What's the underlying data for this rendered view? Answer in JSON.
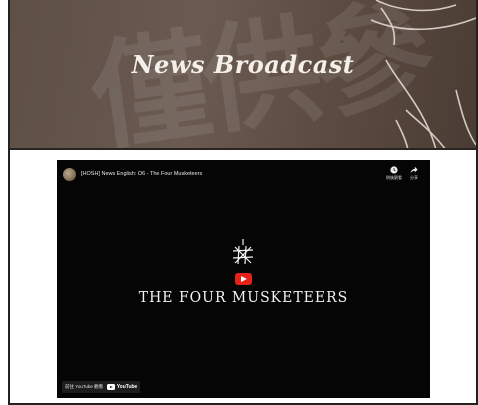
{
  "banner": {
    "title": "News Broadcast",
    "watermark": "僅供參"
  },
  "video": {
    "title": "[HOSH] News English: O6 - The Four Musketeers",
    "actions": [
      {
        "icon": "clock-icon",
        "label": "稍後觀看"
      },
      {
        "icon": "share-icon",
        "label": "分享"
      }
    ],
    "main_title": "THE FOUR MUSKETEERS",
    "watch_on": "前往 YouTube 觀看",
    "youtube_label": "YouTube"
  },
  "colors": {
    "banner_bg": "#5e4f47",
    "play_red": "#e62117",
    "video_bg": "#050505"
  }
}
